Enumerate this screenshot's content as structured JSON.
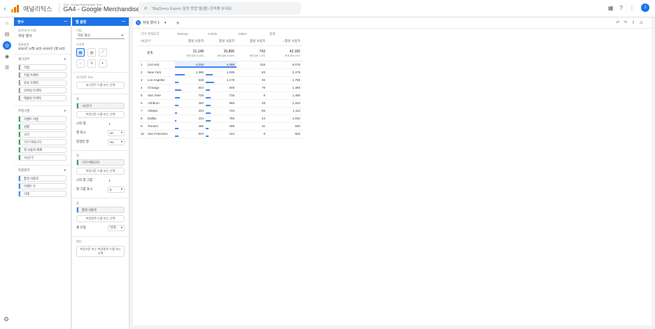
{
  "app": {
    "name": "애널리틱스",
    "property_small": "GA4 - Google Merchandise Store",
    "property": "GA4 - Google Merchandise ...",
    "search_placeholder": "\"BigQuery Export 설정 방법\"을(를) 검색해 보세요",
    "avatar_letter": "J",
    "brand_colors": [
      "#f9ab00",
      "#e37400",
      "#e37400"
    ]
  },
  "variables_panel": {
    "title": "변수",
    "exploration_name_label": "탐색 분석 이름:",
    "exploration_name": "자유 형식",
    "date_label": "맞춤설정",
    "date_range": "2022년 12월 18일~2023년 1월 16일",
    "segments_label": "세그먼트",
    "segments": [
      "직접",
      "직접 트래픽",
      "유료 트래픽",
      "모바일 트래픽",
      "태블릿 트래픽"
    ],
    "dimensions_label": "측정기준",
    "dimensions": [
      "이벤트 이름",
      "성별",
      "국가",
      "기기 카테고리",
      "첫 사용자 매체",
      "시/군/구"
    ],
    "metrics_label": "측정항목",
    "metrics": [
      "활성 사용자",
      "이벤트 수",
      "거래"
    ]
  },
  "settings_panel": {
    "title": "탭 설정",
    "technique_label": "기법",
    "technique": "자유 형식",
    "visualization_label": "시각화",
    "segment_compare_label": "세그먼트 비교",
    "segment_drop": "세그먼트 드롭 또는 선택",
    "rows_label": "행",
    "row_chip": "시/군/구",
    "row_drop": "측정기준 드롭 또는 선택",
    "start_row_label": "시작 행",
    "start_row": "1",
    "show_rows_label": "행 표시",
    "show_rows": "10",
    "nested_rows_label": "중첩된 행",
    "nested_rows": "No",
    "columns_label": "열",
    "column_chip": "기기 카테고리",
    "column_drop": "측정기준 드롭 또는 선택",
    "start_col_label": "시작 열 그룹",
    "start_col": "1",
    "show_cols_label": "열 그룹 표시",
    "show_cols": "5",
    "values_label": "값",
    "value_chip": "활성 사용자",
    "value_drop": "측정항목 드롭 또는 선택",
    "cell_type_label": "셀 유형",
    "cell_type": "막대...",
    "filters_label": "필터",
    "filter_drop": "측정기준 또는 측정항목 드롭 또는 선택"
  },
  "canvas": {
    "tab_label": "자유 형식 1",
    "col_header": "기기 카테고리",
    "row_header": "시/군/구",
    "columns": [
      "desktop",
      "mobile",
      "tablet",
      "총계"
    ],
    "metric": "활성 사용자",
    "total_metric": "↓활성 사용자",
    "total_label": "총계",
    "totals": [
      {
        "value": "21,148",
        "sub": "총계 대비 50.16%"
      },
      {
        "value": "20,896",
        "sub": "총계 대비 49.56%"
      },
      {
        "value": "743",
        "sub": "총계 대비 1.76%"
      },
      {
        "value": "42,165",
        "sub": "총계 대비 100%"
      }
    ],
    "rows": [
      {
        "idx": "1",
        "city": "(not set)",
        "desktop": "4,316",
        "mobile": "4,468",
        "tablet": "318",
        "total": "9,078",
        "d": 4316,
        "m": 4468
      },
      {
        "idx": "2",
        "city": "New York",
        "desktop": "1,365",
        "mobile": "1,039",
        "tablet": "83",
        "total": "2,479",
        "d": 1365,
        "m": 1039
      },
      {
        "idx": "3",
        "city": "Los Angeles",
        "desktop": "538",
        "mobile": "1,176",
        "tablet": "46",
        "total": "1,759",
        "d": 538,
        "m": 1176
      },
      {
        "idx": "4",
        "city": "Chicago",
        "desktop": "844",
        "mobile": "649",
        "tablet": "79",
        "total": "1,466",
        "d": 844,
        "m": 649
      },
      {
        "idx": "5",
        "city": "San Jose",
        "desktop": "726",
        "mobile": "715",
        "tablet": "8",
        "total": "1,456",
        "d": 726,
        "m": 715
      },
      {
        "idx": "6",
        "city": "Ashburn",
        "desktop": "492",
        "mobile": "665",
        "tablet": "48",
        "total": "1,204",
        "d": 492,
        "m": 665
      },
      {
        "idx": "7",
        "city": "Atlanta",
        "desktop": "334",
        "mobile": "723",
        "tablet": "56",
        "total": "1,112",
        "d": 334,
        "m": 723
      },
      {
        "idx": "8",
        "city": "Dallas",
        "desktop": "234",
        "mobile": "756",
        "tablet": "44",
        "total": "1,032",
        "d": 234,
        "m": 756
      },
      {
        "idx": "9",
        "city": "Toronto",
        "desktop": "485",
        "mobile": "409",
        "tablet": "41",
        "total": "930",
        "d": 485,
        "m": 409
      },
      {
        "idx": "10",
        "city": "San Francisco",
        "desktop": "504",
        "mobile": "424",
        "tablet": "8",
        "total": "926",
        "d": 504,
        "m": 424
      }
    ]
  }
}
